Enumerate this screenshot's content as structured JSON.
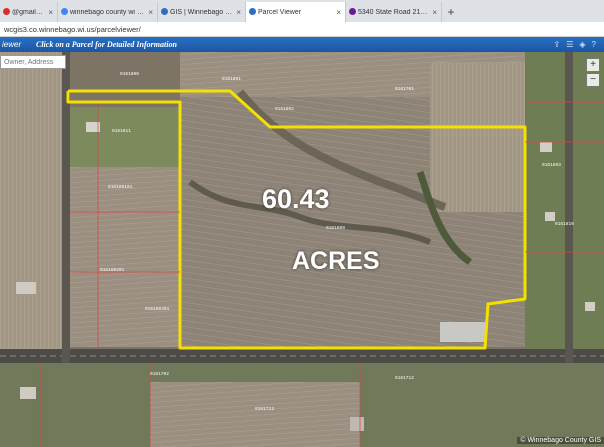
{
  "browser": {
    "tabs": [
      {
        "label": "@gmail.cc",
        "favicon_color": "#d93025",
        "active": false
      },
      {
        "label": "winnebago county wi - Google S",
        "favicon_color": "#4285f4",
        "active": false
      },
      {
        "label": "GIS | Winnebago County",
        "favicon_color": "#2a6fc2",
        "active": false
      },
      {
        "label": "Parcel Viewer",
        "favicon_color": "#2a6fc2",
        "active": true
      },
      {
        "label": "5340 State Road 21, Omro, WI 5",
        "favicon_color": "#6a1b9a",
        "active": false
      }
    ],
    "close_glyph": "×",
    "new_tab_glyph": "+",
    "url": "wcgis3.co.winnebago.wi.us/parcelviewer/"
  },
  "app": {
    "title": "iewer",
    "instruction": "Click on a Parcel for Detailed Information",
    "toolbar_icons": [
      "share-icon",
      "menu-icon",
      "layers-icon",
      "help-icon"
    ]
  },
  "search": {
    "placeholder": "Owner, Address"
  },
  "zoom": {
    "in": "+",
    "out": "−"
  },
  "overlay": {
    "acreage": "60.43",
    "unit": "ACRES",
    "outline_color": "#f5e100"
  },
  "parcel_labels": [
    "0161800",
    "0161802",
    "0161811",
    "016180101",
    "0161809",
    "016180201",
    "0161701",
    "0161801",
    "016180401",
    "0161803",
    "0161702",
    "0161712",
    "0161713",
    "0161810"
  ],
  "copyright": "© Winnebago County GIS"
}
